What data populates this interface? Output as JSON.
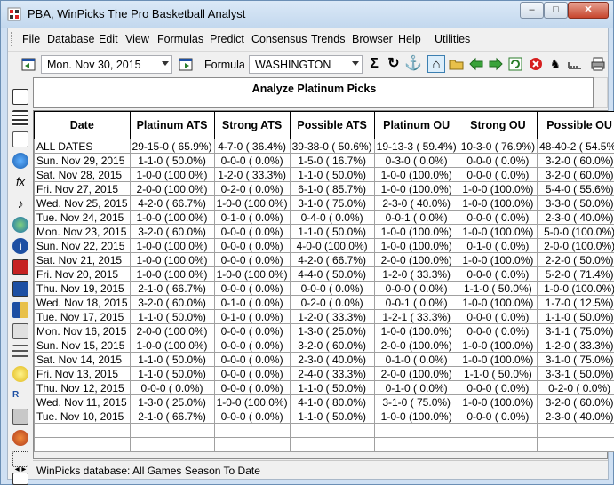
{
  "window": {
    "title": "PBA, WinPicks  The Pro Basketball Analyst",
    "minimize": "–",
    "maximize": "□",
    "close": "✕"
  },
  "menu": [
    {
      "label": "File"
    },
    {
      "label": "Database"
    },
    {
      "label": "Edit"
    },
    {
      "label": "View"
    },
    {
      "label": "Formulas"
    },
    {
      "label": "Predict"
    },
    {
      "label": "Consensus"
    },
    {
      "label": "Trends"
    },
    {
      "label": "Browser"
    },
    {
      "label": "Help"
    },
    {
      "label": "Utilities"
    }
  ],
  "toolbar": {
    "date_value": "Mon. Nov 30, 2015",
    "formula_label": "Formula",
    "formula_value": "WASHINGTON"
  },
  "header": {
    "title": "Analyze Platinum Picks"
  },
  "grid": {
    "columns": [
      "Date",
      "Platinum ATS",
      "Strong ATS",
      "Possible ATS",
      "Platinum OU",
      "Strong OU",
      "Possible OU"
    ],
    "rows": [
      [
        "ALL DATES",
        "29-15-0 ( 65.9%)",
        "4-7-0 ( 36.4%)",
        "39-38-0 ( 50.6%)",
        "19-13-3 ( 59.4%)",
        "10-3-0 ( 76.9%)",
        "48-40-2 ( 54.5%)"
      ],
      [
        "Sun. Nov 29, 2015",
        "1-1-0 ( 50.0%)",
        "0-0-0 ( 0.0%)",
        "1-5-0 ( 16.7%)",
        "0-3-0 ( 0.0%)",
        "0-0-0 ( 0.0%)",
        "3-2-0 ( 60.0%)"
      ],
      [
        "Sat. Nov 28, 2015",
        "1-0-0 (100.0%)",
        "1-2-0 ( 33.3%)",
        "1-1-0 ( 50.0%)",
        "1-0-0 (100.0%)",
        "0-0-0 ( 0.0%)",
        "3-2-0 ( 60.0%)"
      ],
      [
        "Fri. Nov 27, 2015",
        "2-0-0 (100.0%)",
        "0-2-0 ( 0.0%)",
        "6-1-0 ( 85.7%)",
        "1-0-0 (100.0%)",
        "1-0-0 (100.0%)",
        "5-4-0 ( 55.6%)"
      ],
      [
        "Wed. Nov 25, 2015",
        "4-2-0 ( 66.7%)",
        "1-0-0 (100.0%)",
        "3-1-0 ( 75.0%)",
        "2-3-0 ( 40.0%)",
        "1-0-0 (100.0%)",
        "3-3-0 ( 50.0%)"
      ],
      [
        "Tue. Nov 24, 2015",
        "1-0-0 (100.0%)",
        "0-1-0 ( 0.0%)",
        "0-4-0 ( 0.0%)",
        "0-0-1 ( 0.0%)",
        "0-0-0 ( 0.0%)",
        "2-3-0 ( 40.0%)"
      ],
      [
        "Mon. Nov 23, 2015",
        "3-2-0 ( 60.0%)",
        "0-0-0 ( 0.0%)",
        "1-1-0 ( 50.0%)",
        "1-0-0 (100.0%)",
        "1-0-0 (100.0%)",
        "5-0-0 (100.0%)"
      ],
      [
        "Sun. Nov 22, 2015",
        "1-0-0 (100.0%)",
        "0-0-0 ( 0.0%)",
        "4-0-0 (100.0%)",
        "1-0-0 (100.0%)",
        "0-1-0 ( 0.0%)",
        "2-0-0 (100.0%)"
      ],
      [
        "Sat. Nov 21, 2015",
        "1-0-0 (100.0%)",
        "0-0-0 ( 0.0%)",
        "4-2-0 ( 66.7%)",
        "2-0-0 (100.0%)",
        "1-0-0 (100.0%)",
        "2-2-0 ( 50.0%)"
      ],
      [
        "Fri. Nov 20, 2015",
        "1-0-0 (100.0%)",
        "1-0-0 (100.0%)",
        "4-4-0 ( 50.0%)",
        "1-2-0 ( 33.3%)",
        "0-0-0 ( 0.0%)",
        "5-2-0 ( 71.4%)"
      ],
      [
        "Thu. Nov 19, 2015",
        "2-1-0 ( 66.7%)",
        "0-0-0 ( 0.0%)",
        "0-0-0 ( 0.0%)",
        "0-0-0 ( 0.0%)",
        "1-1-0 ( 50.0%)",
        "1-0-0 (100.0%)"
      ],
      [
        "Wed. Nov 18, 2015",
        "3-2-0 ( 60.0%)",
        "0-1-0 ( 0.0%)",
        "0-2-0 ( 0.0%)",
        "0-0-1 ( 0.0%)",
        "1-0-0 (100.0%)",
        "1-7-0 ( 12.5%)"
      ],
      [
        "Tue. Nov 17, 2015",
        "1-1-0 ( 50.0%)",
        "0-1-0 ( 0.0%)",
        "1-2-0 ( 33.3%)",
        "1-2-1 ( 33.3%)",
        "0-0-0 ( 0.0%)",
        "1-1-0 ( 50.0%)"
      ],
      [
        "Mon. Nov 16, 2015",
        "2-0-0 (100.0%)",
        "0-0-0 ( 0.0%)",
        "1-3-0 ( 25.0%)",
        "1-0-0 (100.0%)",
        "0-0-0 ( 0.0%)",
        "3-1-1 ( 75.0%)"
      ],
      [
        "Sun. Nov 15, 2015",
        "1-0-0 (100.0%)",
        "0-0-0 ( 0.0%)",
        "3-2-0 ( 60.0%)",
        "2-0-0 (100.0%)",
        "1-0-0 (100.0%)",
        "1-2-0 ( 33.3%)"
      ],
      [
        "Sat. Nov 14, 2015",
        "1-1-0 ( 50.0%)",
        "0-0-0 ( 0.0%)",
        "2-3-0 ( 40.0%)",
        "0-1-0 ( 0.0%)",
        "1-0-0 (100.0%)",
        "3-1-0 ( 75.0%)"
      ],
      [
        "Fri. Nov 13, 2015",
        "1-1-0 ( 50.0%)",
        "0-0-0 ( 0.0%)",
        "2-4-0 ( 33.3%)",
        "2-0-0 (100.0%)",
        "1-1-0 ( 50.0%)",
        "3-3-1 ( 50.0%)"
      ],
      [
        "Thu. Nov 12, 2015",
        "0-0-0 ( 0.0%)",
        "0-0-0 ( 0.0%)",
        "1-1-0 ( 50.0%)",
        "0-1-0 ( 0.0%)",
        "0-0-0 ( 0.0%)",
        "0-2-0 ( 0.0%)"
      ],
      [
        "Wed. Nov 11, 2015",
        "1-3-0 ( 25.0%)",
        "1-0-0 (100.0%)",
        "4-1-0 ( 80.0%)",
        "3-1-0 ( 75.0%)",
        "1-0-0 (100.0%)",
        "3-2-0 ( 60.0%)"
      ],
      [
        "Tue. Nov 10, 2015",
        "2-1-0 ( 66.7%)",
        "0-0-0 ( 0.0%)",
        "1-1-0 ( 50.0%)",
        "1-0-0 (100.0%)",
        "0-0-0 ( 0.0%)",
        "2-3-0 ( 40.0%)"
      ]
    ]
  },
  "status": {
    "text": "WinPicks database:  All Games Season To Date",
    "nav": "◂ ▸"
  },
  "icons": {
    "toolbar": [
      "calendar-back-icon",
      "calendar-forward-icon",
      "sigma-icon",
      "refresh-icon",
      "anchor-icon",
      "home-icon",
      "open-folder-icon",
      "arrow-left-icon",
      "arrow-right-icon",
      "recalc-icon",
      "stop-icon",
      "wizard-icon",
      "ruler-icon",
      "printer-icon"
    ],
    "sidebar": [
      "scoreboard-icon",
      "list-icon",
      "notes-icon",
      "globe-icon",
      "function-icon",
      "music-icon",
      "world-icon",
      "info-icon",
      "book-icon",
      "stats-icon",
      "chart-icon",
      "filter-icon",
      "bars-icon",
      "bulb-icon",
      "rpl-icon",
      "tools-icon",
      "basketball-icon",
      "network-icon",
      "report-icon"
    ]
  }
}
